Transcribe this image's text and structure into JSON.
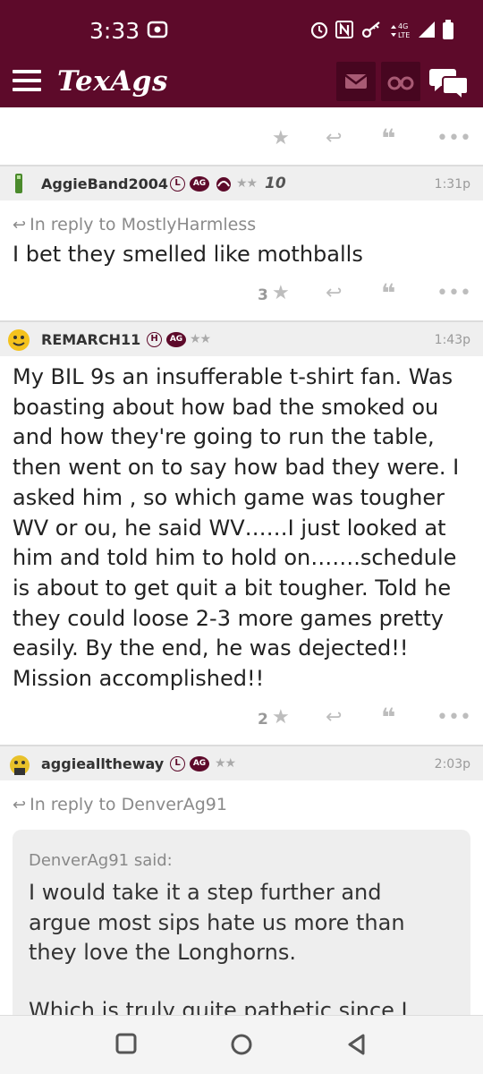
{
  "status_bar": {
    "time": "3:33",
    "network": "4G LTE"
  },
  "header": {
    "logo": "TexAgs",
    "icons": [
      "menu-icon",
      "mail-icon",
      "binoculars-icon",
      "chat-icon"
    ]
  },
  "colors": {
    "brand": "#5d0a2a",
    "header_button": "#470620",
    "post_header_bg": "#efefef",
    "quote_bg": "#eeeeee"
  },
  "posts": [
    {
      "username": "AggieBand2004",
      "badges": [
        "L",
        "AG"
      ],
      "stars": "★★",
      "rank": "10",
      "time": "1:31p",
      "reply_to": "In reply to MostlyHarmless",
      "text": "I bet they smelled like mothballs",
      "likes": "3"
    },
    {
      "username": "REMARCH11",
      "badges": [
        "H",
        "AG"
      ],
      "stars": "★★",
      "time": "1:43p",
      "text": "My BIL 9s an insufferable t-shirt fan. Was boasting about how bad the smoked ou and how they're going to run the table, then went on to say how bad they were. I asked him , so which game was tougher WV or ou, he said WV……I just looked at him and told him to hold on…….schedule is about to get quit a bit tougher. Told he they could loose 2-3 more games pretty easily. By the end, he was dejected!! Mission accomplished!!",
      "likes": "2"
    },
    {
      "username": "aggiealltheway",
      "badges": [
        "L",
        "AG"
      ],
      "stars": "★★",
      "time": "2:03p",
      "reply_to": "In reply to DenverAg91",
      "quote_author": "DenverAg91 said:",
      "quote_text": "I would take it a step further and argue most sips hate us more than they love the Longhorns.",
      "quote_text_2": "Which is truly quite pathetic since I"
    }
  ]
}
